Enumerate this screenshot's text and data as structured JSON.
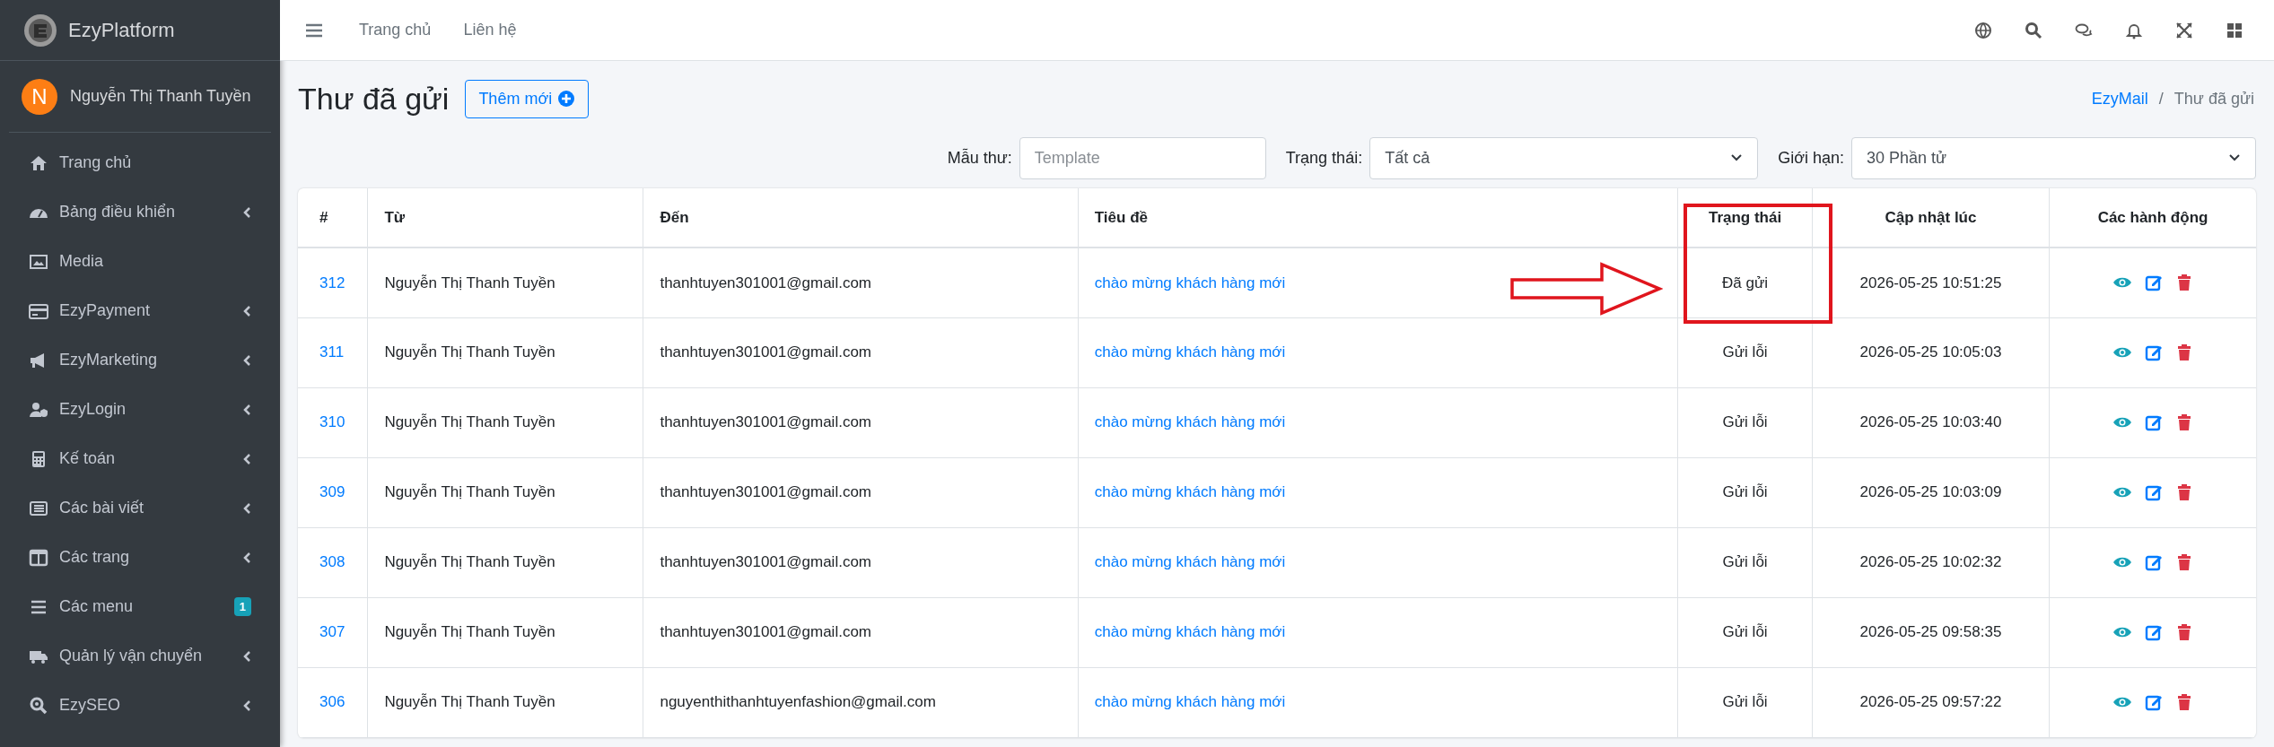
{
  "sidebar": {
    "brand": "EzyPlatform",
    "user": {
      "initial": "N",
      "name": "Nguyễn Thị Thanh Tuyền"
    },
    "items": [
      {
        "label": "Trang chủ",
        "has_submenu": false
      },
      {
        "label": "Bảng điều khiển",
        "has_submenu": true
      },
      {
        "label": "Media",
        "has_submenu": false
      },
      {
        "label": "EzyPayment",
        "has_submenu": true
      },
      {
        "label": "EzyMarketing",
        "has_submenu": true
      },
      {
        "label": "EzyLogin",
        "has_submenu": true
      },
      {
        "label": "Kế toán",
        "has_submenu": true
      },
      {
        "label": "Các bài viết",
        "has_submenu": true
      },
      {
        "label": "Các trang",
        "has_submenu": true
      },
      {
        "label": "Các menu",
        "has_submenu": false,
        "badge": "1"
      },
      {
        "label": "Quản lý vận chuyển",
        "has_submenu": true
      },
      {
        "label": "EzySEO",
        "has_submenu": true
      }
    ]
  },
  "top_nav": {
    "links": [
      "Trang chủ",
      "Liên hệ"
    ]
  },
  "page": {
    "title": "Thư đã gửi",
    "add_button": "Thêm mới",
    "breadcrumb": [
      "EzyMail",
      "Thư đã gửi"
    ],
    "breadcrumb_separator": "/"
  },
  "filters": [
    {
      "label": "Mẫu thư:",
      "kind": "input",
      "placeholder": "Template"
    },
    {
      "label": "Trạng thái:",
      "kind": "select",
      "value": "Tất cả"
    },
    {
      "label": "Giới hạn:",
      "kind": "select",
      "value": "30 Phần tử"
    }
  ],
  "table": {
    "columns": [
      "#",
      "Từ",
      "Đến",
      "Tiêu đề",
      "Trạng thái",
      "Cập nhật lúc",
      "Các hành động"
    ],
    "rows": [
      {
        "id": "312",
        "from": "Nguyễn Thị Thanh Tuyền",
        "to": "thanhtuyen301001@gmail.com",
        "subject": "chào mừng khách hàng mới",
        "status": "Đã gửi",
        "updated": "2026-05-25 10:51:25"
      },
      {
        "id": "311",
        "from": "Nguyễn Thị Thanh Tuyền",
        "to": "thanhtuyen301001@gmail.com",
        "subject": "chào mừng khách hàng mới",
        "status": "Gửi lỗi",
        "updated": "2026-05-25 10:05:03"
      },
      {
        "id": "310",
        "from": "Nguyễn Thị Thanh Tuyền",
        "to": "thanhtuyen301001@gmail.com",
        "subject": "chào mừng khách hàng mới",
        "status": "Gửi lỗi",
        "updated": "2026-05-25 10:03:40"
      },
      {
        "id": "309",
        "from": "Nguyễn Thị Thanh Tuyền",
        "to": "thanhtuyen301001@gmail.com",
        "subject": "chào mừng khách hàng mới",
        "status": "Gửi lỗi",
        "updated": "2026-05-25 10:03:09"
      },
      {
        "id": "308",
        "from": "Nguyễn Thị Thanh Tuyền",
        "to": "thanhtuyen301001@gmail.com",
        "subject": "chào mừng khách hàng mới",
        "status": "Gửi lỗi",
        "updated": "2026-05-25 10:02:32"
      },
      {
        "id": "307",
        "from": "Nguyễn Thị Thanh Tuyền",
        "to": "thanhtuyen301001@gmail.com",
        "subject": "chào mừng khách hàng mới",
        "status": "Gửi lỗi",
        "updated": "2026-05-25 09:58:35"
      },
      {
        "id": "306",
        "from": "Nguyễn Thị Thanh Tuyền",
        "to": "nguyenthithanhtuyenfashion@gmail.com",
        "subject": "chào mừng khách hàng mới",
        "status": "Gửi lỗi",
        "updated": "2026-05-25 09:57:22"
      }
    ]
  },
  "annotation": {
    "highlight_box": true,
    "arrow": true
  }
}
